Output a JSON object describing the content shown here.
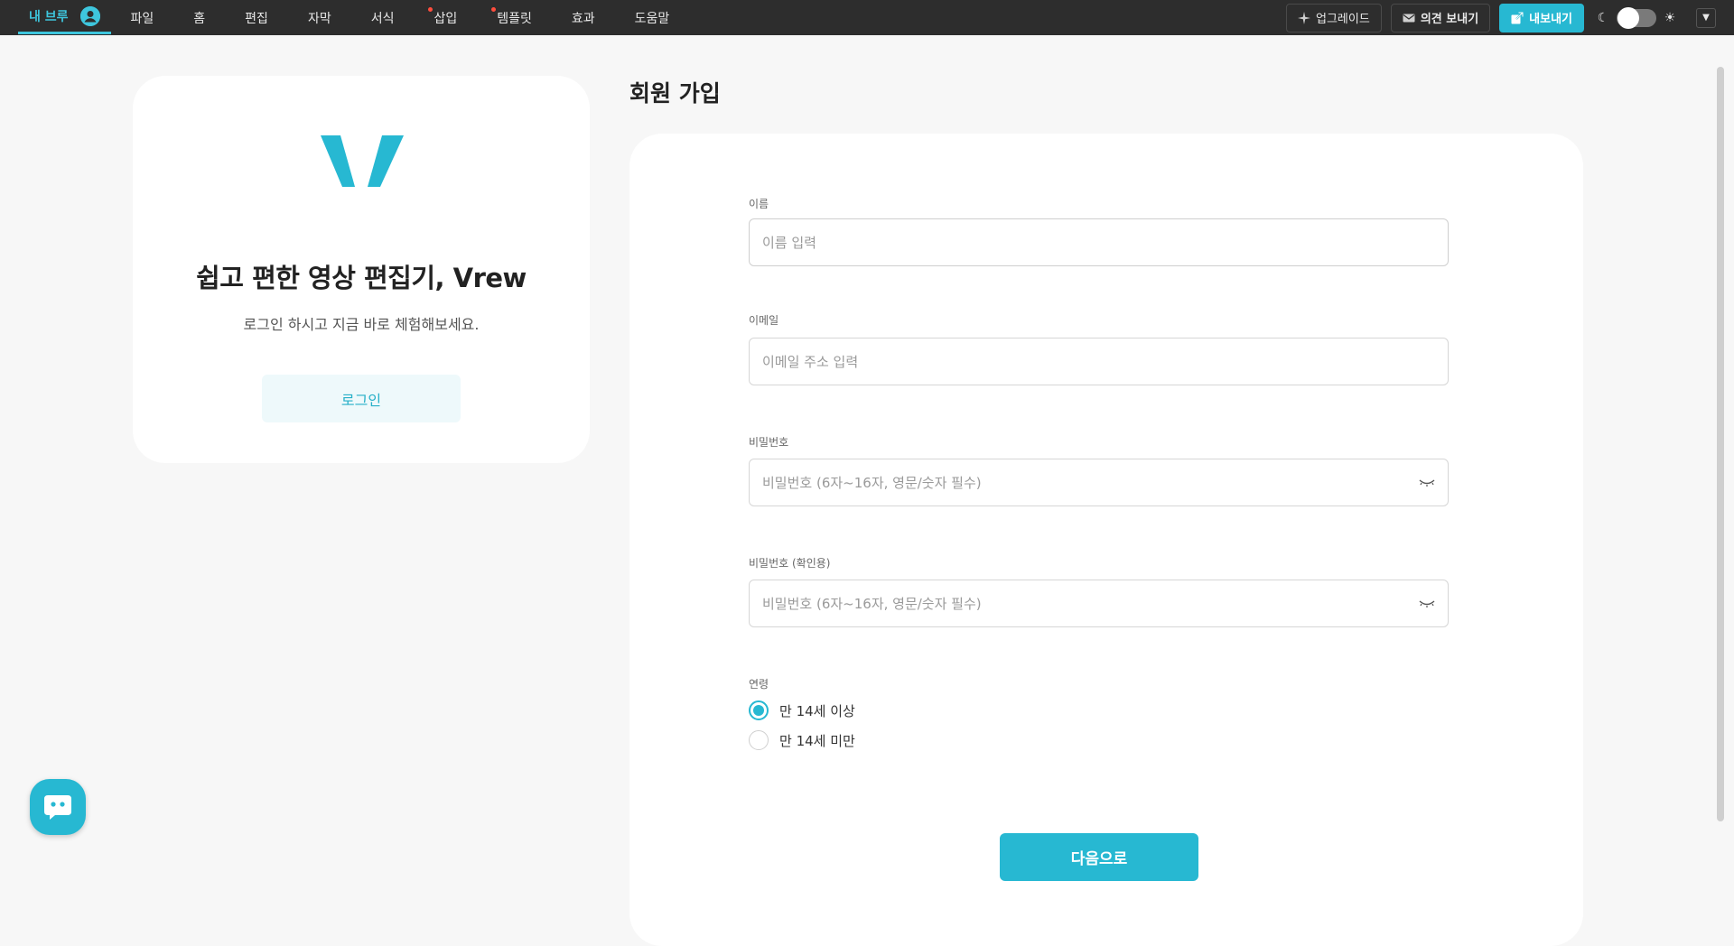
{
  "menu": {
    "my_vrew": "내 브루",
    "items": [
      {
        "label": "파일",
        "dot": false
      },
      {
        "label": "홈",
        "dot": false
      },
      {
        "label": "편집",
        "dot": false
      },
      {
        "label": "자막",
        "dot": false
      },
      {
        "label": "서식",
        "dot": false
      },
      {
        "label": "삽입",
        "dot": true
      },
      {
        "label": "템플릿",
        "dot": true
      },
      {
        "label": "효과",
        "dot": false
      },
      {
        "label": "도움말",
        "dot": false
      }
    ]
  },
  "toolbar": {
    "upgrade_label": "업그레이드",
    "feedback_label": "의견 보내기",
    "export_label": "내보내기",
    "accent_color": "#27b8d2"
  },
  "promo": {
    "headline": "쉽고 편한 영상 편집기, Vrew",
    "subtext": "로그인 하시고 지금 바로 체험해보세요.",
    "login_label": "로그인"
  },
  "signup": {
    "title": "회원 가입",
    "name": {
      "label": "이름",
      "placeholder": "이름 입력",
      "value": ""
    },
    "email": {
      "label": "이메일",
      "placeholder": "이메일 주소 입력",
      "value": ""
    },
    "password": {
      "label": "비밀번호",
      "placeholder": "비밀번호 (6자~16자, 영문/숫자 필수)",
      "value": ""
    },
    "password_confirm": {
      "label": "비밀번호 (확인용)",
      "placeholder": "비밀번호 (6자~16자, 영문/숫자 필수)",
      "value": ""
    },
    "age": {
      "label": "연령",
      "options": [
        {
          "label": "만 14세 이상",
          "checked": true
        },
        {
          "label": "만 14세 미만",
          "checked": false
        }
      ]
    },
    "next_label": "다음으로"
  }
}
